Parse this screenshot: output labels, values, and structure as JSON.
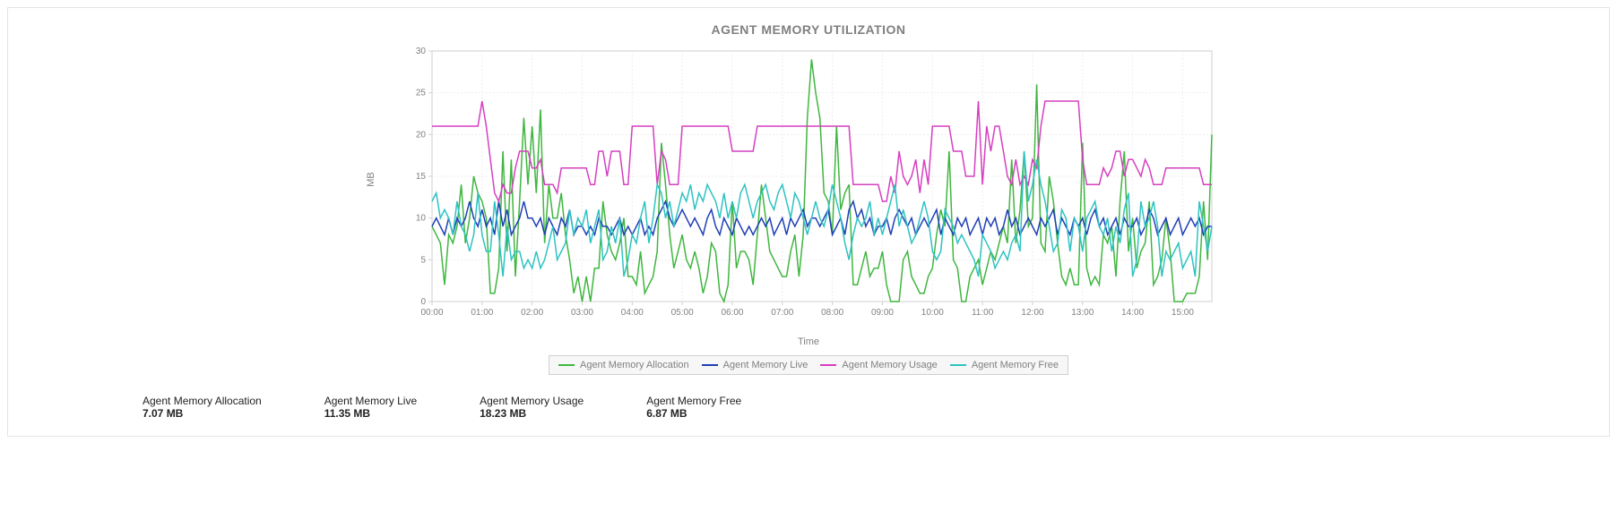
{
  "title": "AGENT MEMORY UTILIZATION",
  "ylabel": "MB",
  "xlabel": "Time",
  "stats": [
    {
      "label": "Agent Memory Allocation",
      "value": "7.07 MB"
    },
    {
      "label": "Agent Memory Live",
      "value": "11.35 MB"
    },
    {
      "label": "Agent Memory Usage",
      "value": "18.23 MB"
    },
    {
      "label": "Agent Memory Free",
      "value": "6.87 MB"
    }
  ],
  "legend": [
    {
      "name": "Agent Memory Allocation",
      "color": "#3fb63f"
    },
    {
      "name": "Agent Memory Live",
      "color": "#1f3fb6"
    },
    {
      "name": "Agent Memory Usage",
      "color": "#d63fc0"
    },
    {
      "name": "Agent Memory Free",
      "color": "#2ec2c2"
    }
  ],
  "chart_data": {
    "type": "line",
    "title": "AGENT MEMORY UTILIZATION",
    "xlabel": "Time",
    "ylabel": "MB",
    "ylim": [
      0,
      30
    ],
    "yticks": [
      0,
      5,
      10,
      15,
      20,
      25,
      30
    ],
    "x_ticks": [
      "00:00",
      "01:00",
      "02:00",
      "03:00",
      "04:00",
      "05:00",
      "06:00",
      "07:00",
      "08:00",
      "09:00",
      "10:00",
      "11:00",
      "12:00",
      "13:00",
      "14:00",
      "15:00"
    ],
    "x": [
      "00:00",
      "00:05",
      "00:10",
      "00:15",
      "00:20",
      "00:25",
      "00:30",
      "00:35",
      "00:40",
      "00:45",
      "00:50",
      "00:55",
      "01:00",
      "01:05",
      "01:10",
      "01:15",
      "01:20",
      "01:25",
      "01:30",
      "01:35",
      "01:40",
      "01:45",
      "01:50",
      "01:55",
      "02:00",
      "02:05",
      "02:10",
      "02:15",
      "02:20",
      "02:25",
      "02:30",
      "02:35",
      "02:40",
      "02:45",
      "02:50",
      "02:55",
      "03:00",
      "03:05",
      "03:10",
      "03:15",
      "03:20",
      "03:25",
      "03:30",
      "03:35",
      "03:40",
      "03:45",
      "03:50",
      "03:55",
      "04:00",
      "04:05",
      "04:10",
      "04:15",
      "04:20",
      "04:25",
      "04:30",
      "04:35",
      "04:40",
      "04:45",
      "04:50",
      "04:55",
      "05:00",
      "05:05",
      "05:10",
      "05:15",
      "05:20",
      "05:25",
      "05:30",
      "05:35",
      "05:40",
      "05:45",
      "05:50",
      "05:55",
      "06:00",
      "06:05",
      "06:10",
      "06:15",
      "06:20",
      "06:25",
      "06:30",
      "06:35",
      "06:40",
      "06:45",
      "06:50",
      "06:55",
      "07:00",
      "07:05",
      "07:10",
      "07:15",
      "07:20",
      "07:25",
      "07:30",
      "07:35",
      "07:40",
      "07:45",
      "07:50",
      "07:55",
      "08:00",
      "08:05",
      "08:10",
      "08:15",
      "08:20",
      "08:25",
      "08:30",
      "08:35",
      "08:40",
      "08:45",
      "08:50",
      "08:55",
      "09:00",
      "09:05",
      "09:10",
      "09:15",
      "09:20",
      "09:25",
      "09:30",
      "09:35",
      "09:40",
      "09:45",
      "09:50",
      "09:55",
      "10:00",
      "10:05",
      "10:10",
      "10:15",
      "10:20",
      "10:25",
      "10:30",
      "10:35",
      "10:40",
      "10:45",
      "10:50",
      "10:55",
      "11:00",
      "11:05",
      "11:10",
      "11:15",
      "11:20",
      "11:25",
      "11:30",
      "11:35",
      "11:40",
      "11:45",
      "11:50",
      "11:55",
      "12:00",
      "12:05",
      "12:10",
      "12:15",
      "12:20",
      "12:25",
      "12:30",
      "12:35",
      "12:40",
      "12:45",
      "12:50",
      "12:55",
      "13:00",
      "13:05",
      "13:10",
      "13:15",
      "13:20",
      "13:25",
      "13:30",
      "13:35",
      "13:40",
      "13:45",
      "13:50",
      "13:55",
      "14:00",
      "14:05",
      "14:10",
      "14:15",
      "14:20",
      "14:25",
      "14:30",
      "14:35",
      "14:40",
      "14:45",
      "14:50",
      "14:55",
      "15:00",
      "15:05",
      "15:10",
      "15:15",
      "15:20",
      "15:25",
      "15:30",
      "15:35"
    ],
    "series": [
      {
        "name": "Agent Memory Allocation",
        "color": "#3fb63f",
        "values": [
          9,
          8,
          7,
          2,
          8,
          7,
          9,
          14,
          7,
          10,
          15,
          13,
          12,
          10,
          1,
          1,
          4,
          18,
          6,
          17,
          3,
          12,
          22,
          14,
          21,
          13,
          23,
          7,
          14,
          10,
          10,
          13,
          8,
          5,
          1,
          3,
          0,
          3,
          0,
          4,
          4,
          12,
          8,
          6,
          5,
          7,
          10,
          3,
          3,
          2,
          6,
          1,
          2,
          3,
          6,
          19,
          14,
          8,
          4,
          6,
          8,
          5,
          4,
          6,
          4,
          1,
          3,
          7,
          6,
          1,
          0,
          2,
          12,
          4,
          6,
          6,
          5,
          2,
          8,
          14,
          10,
          6,
          5,
          4,
          3,
          3,
          6,
          8,
          3,
          8,
          22,
          29,
          25,
          22,
          13,
          12,
          8,
          21,
          11,
          13,
          14,
          2,
          2,
          4,
          6,
          3,
          4,
          4,
          6,
          2,
          0,
          0,
          0,
          5,
          6,
          3,
          2,
          1,
          1,
          3,
          4,
          8,
          11,
          9,
          18,
          5,
          4,
          0,
          0,
          3,
          4,
          5,
          2,
          4,
          6,
          5,
          7,
          9,
          7,
          17,
          7,
          11,
          18,
          9,
          10,
          26,
          7,
          6,
          15,
          12,
          7,
          3,
          2,
          4,
          2,
          2,
          19,
          4,
          2,
          3,
          2,
          8,
          7,
          9,
          3,
          12,
          18,
          6,
          10,
          4,
          6,
          7,
          12,
          2,
          3,
          5,
          10,
          6,
          0,
          0,
          0,
          1,
          1,
          1,
          3,
          12,
          5,
          20
        ]
      },
      {
        "name": "Agent Memory Live",
        "color": "#1f3fb6",
        "values": [
          9,
          10,
          9,
          8,
          10,
          8,
          10,
          9,
          10,
          12,
          10,
          9,
          11,
          9,
          10,
          8,
          12,
          9,
          11,
          8,
          9,
          10,
          12,
          10,
          10,
          9,
          10,
          8,
          10,
          9,
          8,
          10,
          9,
          11,
          8,
          9,
          9,
          8,
          9,
          8,
          10,
          9,
          9,
          8,
          9,
          10,
          8,
          9,
          8,
          9,
          10,
          8,
          9,
          8,
          10,
          11,
          12,
          10,
          9,
          10,
          11,
          10,
          9,
          10,
          9,
          8,
          10,
          11,
          9,
          8,
          10,
          9,
          8,
          10,
          9,
          8,
          9,
          8,
          9,
          10,
          9,
          10,
          8,
          9,
          10,
          8,
          10,
          9,
          10,
          11,
          9,
          10,
          10,
          9,
          10,
          11,
          8,
          9,
          10,
          8,
          11,
          12,
          10,
          11,
          9,
          10,
          8,
          9,
          9,
          10,
          8,
          10,
          11,
          10,
          9,
          10,
          8,
          9,
          10,
          9,
          10,
          11,
          8,
          10,
          9,
          8,
          10,
          9,
          10,
          8,
          9,
          10,
          8,
          10,
          9,
          10,
          8,
          9,
          11,
          9,
          10,
          8,
          9,
          10,
          9,
          8,
          10,
          9,
          10,
          11,
          8,
          10,
          9,
          8,
          10,
          9,
          10,
          8,
          10,
          11,
          9,
          10,
          8,
          9,
          10,
          8,
          10,
          9,
          9,
          10,
          8,
          9,
          11,
          10,
          8,
          9,
          10,
          8,
          9,
          10,
          8,
          9,
          10,
          9,
          10,
          8,
          9,
          9
        ]
      },
      {
        "name": "Agent Memory Usage",
        "color": "#d63fc0",
        "values": [
          21,
          21,
          21,
          21,
          21,
          21,
          21,
          21,
          21,
          21,
          21,
          21,
          24,
          21,
          17,
          13,
          12,
          14,
          13,
          13,
          16,
          18,
          18,
          18,
          16,
          16,
          17,
          14,
          14,
          14,
          13,
          16,
          16,
          16,
          16,
          16,
          16,
          16,
          14,
          14,
          18,
          18,
          15,
          18,
          18,
          18,
          14,
          14,
          21,
          21,
          21,
          21,
          21,
          21,
          14,
          18,
          17,
          14,
          14,
          14,
          21,
          21,
          21,
          21,
          21,
          21,
          21,
          21,
          21,
          21,
          21,
          21,
          18,
          18,
          18,
          18,
          18,
          18,
          21,
          21,
          21,
          21,
          21,
          21,
          21,
          21,
          21,
          21,
          21,
          21,
          21,
          21,
          21,
          21,
          21,
          21,
          21,
          21,
          21,
          21,
          21,
          14,
          14,
          14,
          14,
          14,
          14,
          14,
          12,
          12,
          15,
          13,
          18,
          15,
          14,
          15,
          17,
          13,
          17,
          14,
          21,
          21,
          21,
          21,
          21,
          18,
          18,
          18,
          15,
          15,
          15,
          24,
          14,
          21,
          18,
          21,
          21,
          18,
          15,
          14,
          17,
          14,
          15,
          14,
          17,
          16,
          21,
          24,
          24,
          24,
          24,
          24,
          24,
          24,
          24,
          24,
          17,
          14,
          14,
          14,
          14,
          16,
          15,
          16,
          18,
          18,
          15,
          17,
          17,
          16,
          15,
          17,
          16,
          14,
          14,
          14,
          16,
          16,
          16,
          16,
          16,
          16,
          16,
          16,
          16,
          14,
          14,
          14
        ]
      },
      {
        "name": "Agent Memory Free",
        "color": "#2ec2c2",
        "values": [
          12,
          13,
          10,
          11,
          10,
          8,
          12,
          9,
          8,
          6,
          8,
          13,
          8,
          6,
          6,
          12,
          8,
          3,
          9,
          5,
          6,
          6,
          4,
          5,
          4,
          6,
          4,
          5,
          7,
          9,
          5,
          6,
          7,
          11,
          8,
          10,
          9,
          11,
          7,
          9,
          11,
          5,
          6,
          9,
          7,
          10,
          3,
          5,
          8,
          7,
          10,
          12,
          7,
          10,
          14,
          13,
          10,
          12,
          9,
          11,
          13,
          12,
          14,
          11,
          13,
          12,
          14,
          13,
          12,
          10,
          13,
          10,
          12,
          10,
          13,
          14,
          12,
          10,
          12,
          13,
          14,
          12,
          11,
          13,
          14,
          12,
          10,
          13,
          12,
          10,
          8,
          10,
          12,
          10,
          9,
          11,
          14,
          12,
          10,
          7,
          5,
          8,
          10,
          9,
          10,
          12,
          8,
          10,
          8,
          10,
          12,
          14,
          9,
          11,
          9,
          7,
          8,
          10,
          12,
          10,
          6,
          5,
          6,
          11,
          10,
          9,
          7,
          8,
          7,
          6,
          5,
          3,
          8,
          7,
          6,
          4,
          5,
          6,
          5,
          7,
          8,
          6,
          18,
          12,
          14,
          17,
          14,
          12,
          9,
          6,
          7,
          11,
          10,
          6,
          10,
          9,
          6,
          10,
          11,
          12,
          9,
          8,
          10,
          6,
          9,
          7,
          11,
          13,
          3,
          5,
          12,
          9,
          10,
          12,
          9,
          3,
          6,
          5,
          6,
          7,
          4,
          5,
          6,
          3,
          12,
          9,
          6,
          9
        ]
      }
    ]
  }
}
